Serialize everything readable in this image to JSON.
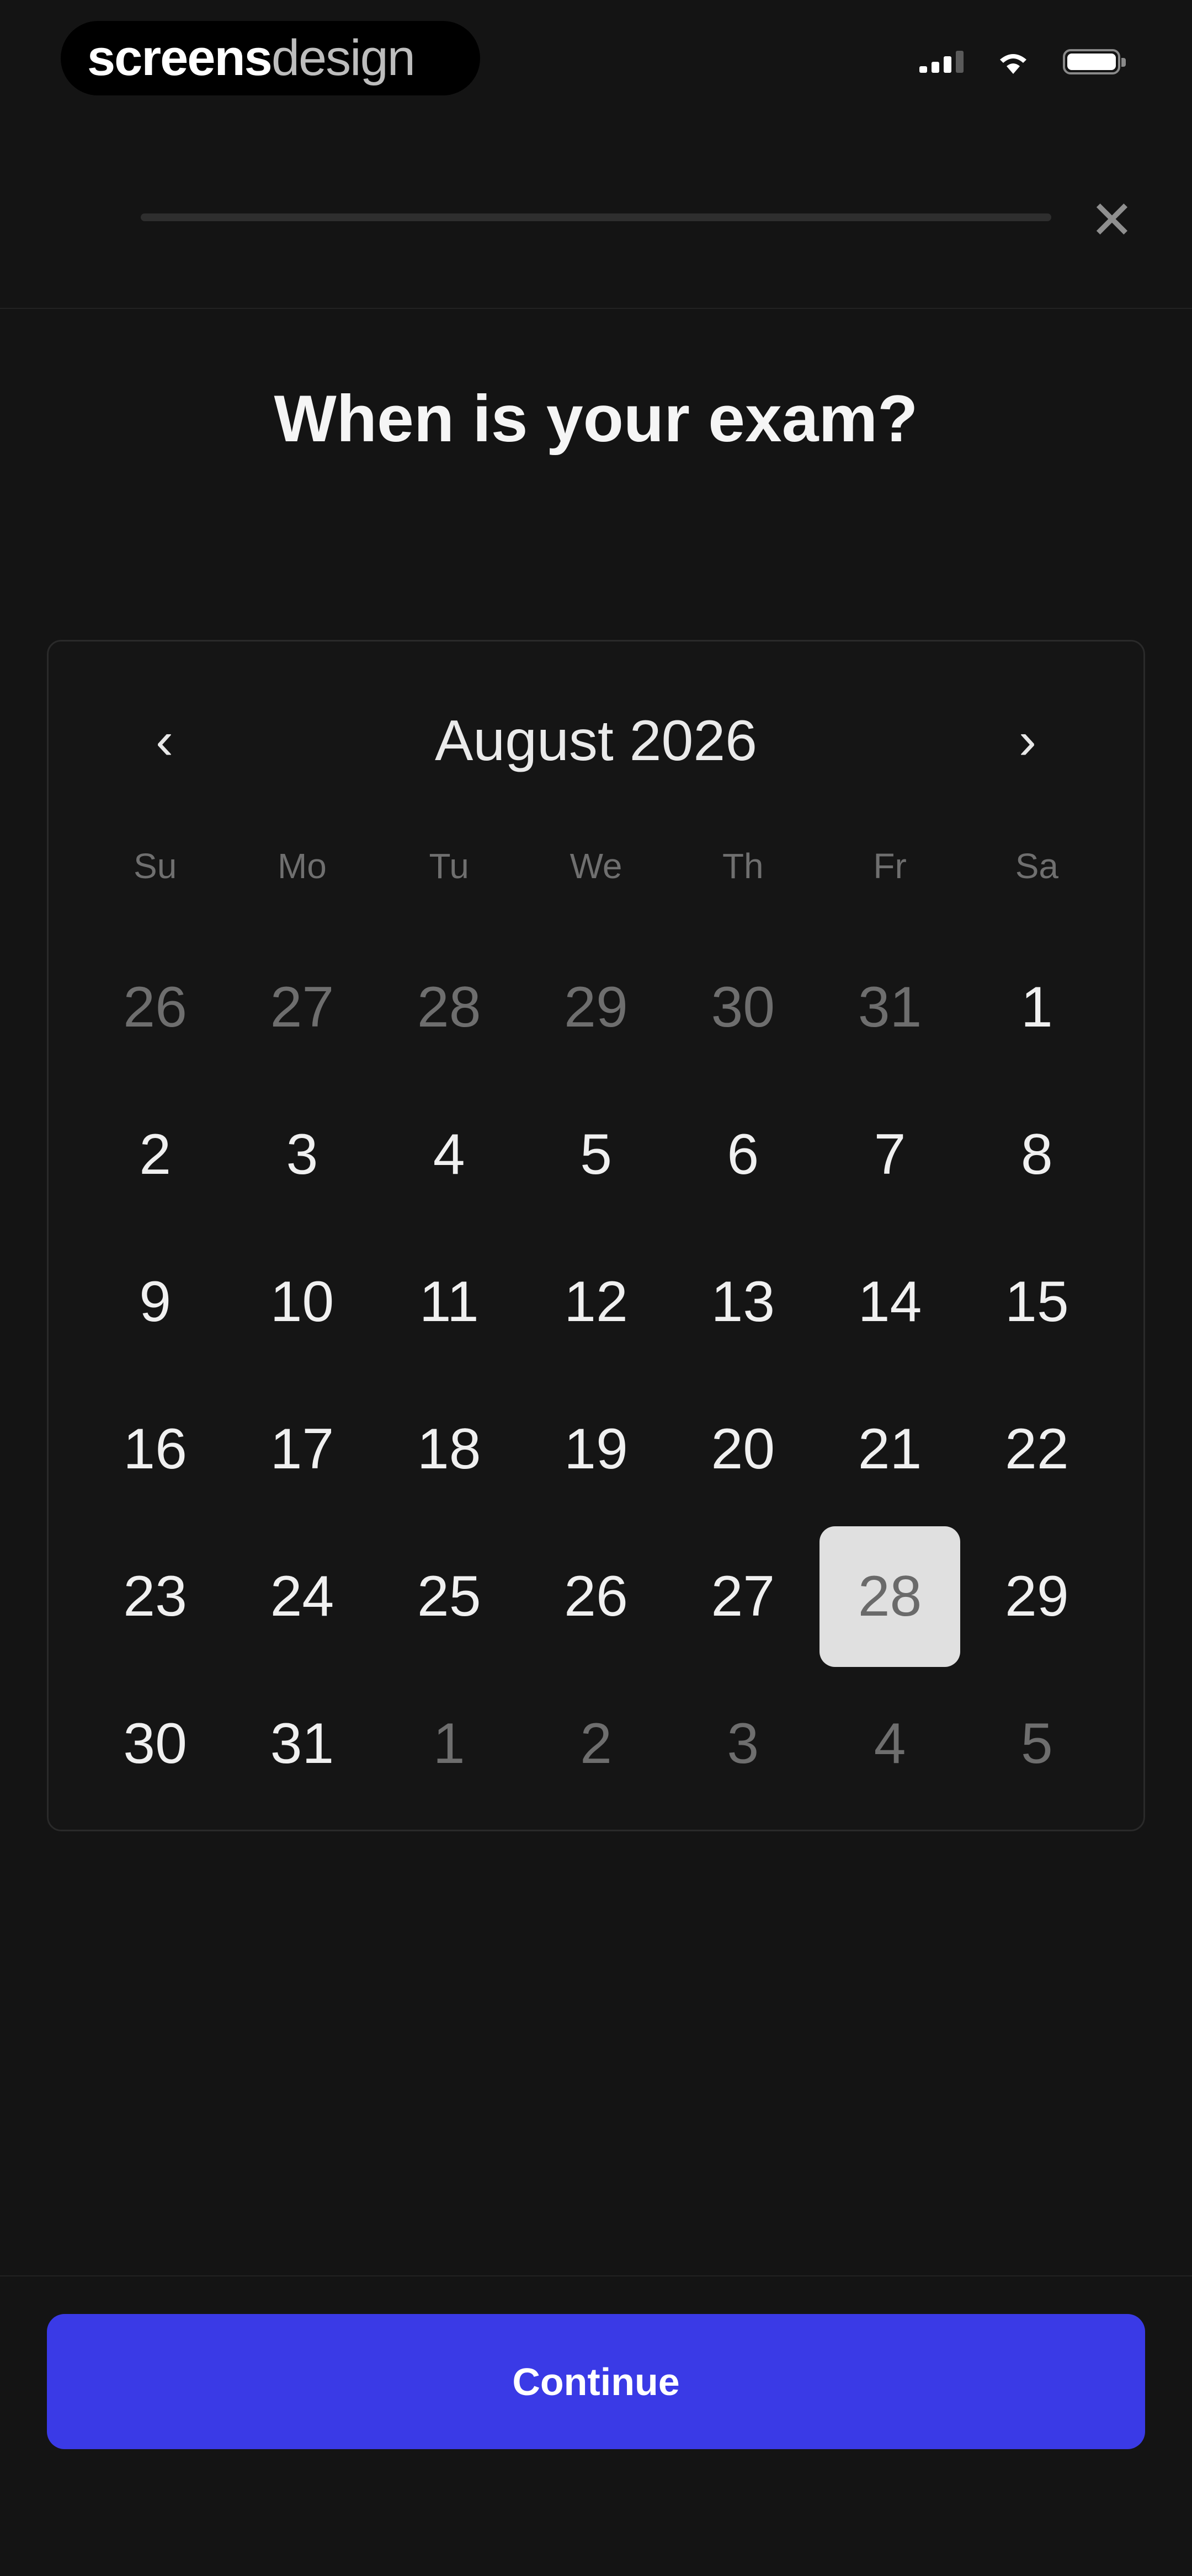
{
  "status_bar": {
    "brand_strong": "screens",
    "brand_light": "design",
    "signal_icon": "signal-icon",
    "wifi_icon": "wifi-icon",
    "battery_icon": "battery-icon"
  },
  "header": {
    "progress": 0.0,
    "close_icon_glyph": "✕",
    "close_icon": "close-icon"
  },
  "title": "When is your exam?",
  "calendar": {
    "month_label": "August 2026",
    "prev_glyph": "‹",
    "next_glyph": "›",
    "weekdays": [
      "Su",
      "Mo",
      "Tu",
      "We",
      "Th",
      "Fr",
      "Sa"
    ],
    "weeks": [
      [
        {
          "d": "26",
          "m": true
        },
        {
          "d": "27",
          "m": true
        },
        {
          "d": "28",
          "m": true
        },
        {
          "d": "29",
          "m": true
        },
        {
          "d": "30",
          "m": true
        },
        {
          "d": "31",
          "m": true
        },
        {
          "d": "1",
          "m": false
        }
      ],
      [
        {
          "d": "2",
          "m": false
        },
        {
          "d": "3",
          "m": false
        },
        {
          "d": "4",
          "m": false
        },
        {
          "d": "5",
          "m": false
        },
        {
          "d": "6",
          "m": false
        },
        {
          "d": "7",
          "m": false
        },
        {
          "d": "8",
          "m": false
        }
      ],
      [
        {
          "d": "9",
          "m": false
        },
        {
          "d": "10",
          "m": false
        },
        {
          "d": "11",
          "m": false
        },
        {
          "d": "12",
          "m": false
        },
        {
          "d": "13",
          "m": false
        },
        {
          "d": "14",
          "m": false
        },
        {
          "d": "15",
          "m": false
        }
      ],
      [
        {
          "d": "16",
          "m": false
        },
        {
          "d": "17",
          "m": false
        },
        {
          "d": "18",
          "m": false
        },
        {
          "d": "19",
          "m": false
        },
        {
          "d": "20",
          "m": false
        },
        {
          "d": "21",
          "m": false
        },
        {
          "d": "22",
          "m": false
        }
      ],
      [
        {
          "d": "23",
          "m": false
        },
        {
          "d": "24",
          "m": false
        },
        {
          "d": "25",
          "m": false
        },
        {
          "d": "26",
          "m": false
        },
        {
          "d": "27",
          "m": false
        },
        {
          "d": "28",
          "m": false,
          "selected": true
        },
        {
          "d": "29",
          "m": false
        }
      ],
      [
        {
          "d": "30",
          "m": false
        },
        {
          "d": "31",
          "m": false
        },
        {
          "d": "1",
          "m": true
        },
        {
          "d": "2",
          "m": true
        },
        {
          "d": "3",
          "m": true
        },
        {
          "d": "4",
          "m": true
        },
        {
          "d": "5",
          "m": true
        }
      ]
    ],
    "selected_date": "28"
  },
  "continue_label": "Continue",
  "colors": {
    "background": "#141414",
    "accent": "#3a3ae6",
    "selected_day_bg": "#e0e0e0",
    "muted_text": "#6e6e6e"
  }
}
